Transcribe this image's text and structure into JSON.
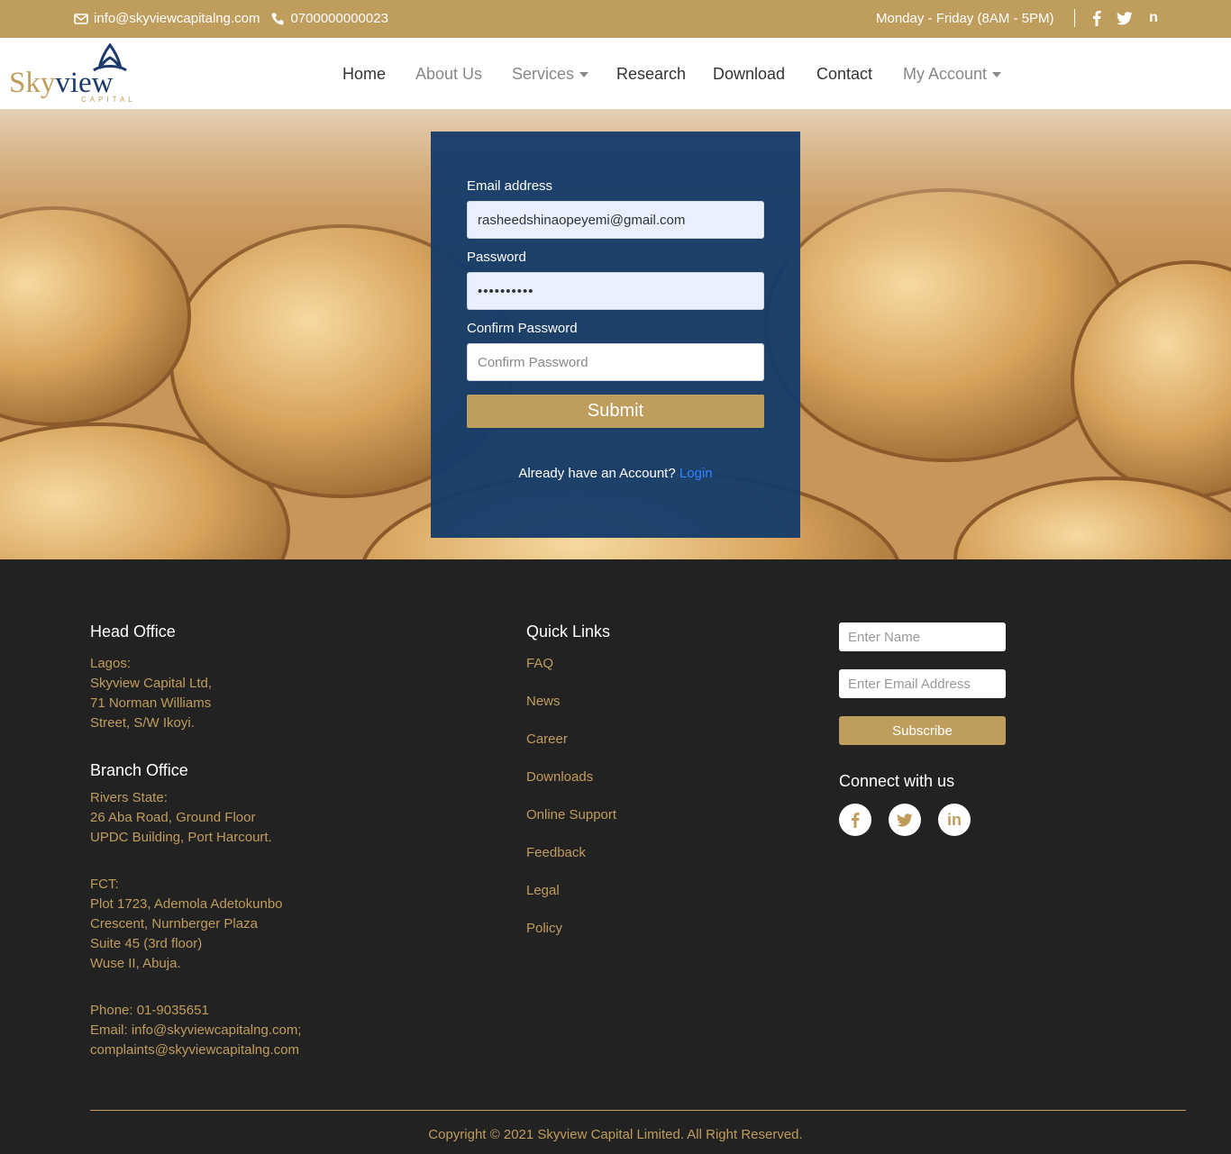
{
  "topbar": {
    "email": "info@skyviewcapitalng.com",
    "phone": "0700000000023",
    "hours": "Monday - Friday (8AM - 5PM)",
    "social": [
      "facebook-icon",
      "twitter-icon",
      "linkedin-icon"
    ],
    "background": "#bf9d5d"
  },
  "brand": {
    "name_sky": "Sky",
    "name_view": "view",
    "sub": "CAPITAL"
  },
  "nav": {
    "home": "Home",
    "about": "About Us",
    "services": "Services",
    "research": "Research",
    "download": "Download",
    "contact": "Contact",
    "account": "My Account"
  },
  "form": {
    "email_label": "Email address",
    "email_value": "rasheedshinaopeyemi@gmail.com",
    "password_label": "Password",
    "password_value": "••••••••••",
    "confirm_label": "Confirm Password",
    "confirm_placeholder": "Confirm Password",
    "submit_label": "Submit",
    "already_text": "Already have an Account?",
    "login_link": "Login",
    "card_color": "#163c6a"
  },
  "footer": {
    "head_office_title": "Head Office",
    "head_office_lines": [
      "Lagos:",
      "Skyview Capital Ltd,",
      "71 Norman Williams",
      "Street, S/W Ikoyi."
    ],
    "branch_title": "Branch Office",
    "branch_lines": [
      "Rivers State:",
      "26 Aba Road, Ground Floor",
      "UPDC Building, Port Harcourt."
    ],
    "fct_lines": [
      "FCT:",
      "Plot 1723, Ademola Adetokunbo",
      "Crescent, Nurnberger Plaza",
      "Suite 45 (3rd floor)",
      "Wuse II, Abuja."
    ],
    "contact_lines": [
      "Phone: 01-9035651",
      "Email: info@skyviewcapitalng.com;",
      "complaints@skyviewcapitalng.com"
    ],
    "quick_links_title": "Quick Links",
    "quick_links": [
      "FAQ",
      "News",
      "Career",
      "Downloads",
      "Online Support",
      "Feedback",
      "Legal",
      "Policy"
    ],
    "name_placeholder": "Enter Name",
    "email_placeholder": "Enter Email Address",
    "subscribe_label": "Subscribe",
    "connect_title": "Connect with us",
    "connect_icons": [
      "facebook-icon",
      "twitter-icon",
      "linkedin-icon"
    ],
    "copyright": "Copyright © 2021 Skyview Capital Limited. All Right Reserved.",
    "accent": "#bf9d5d"
  }
}
